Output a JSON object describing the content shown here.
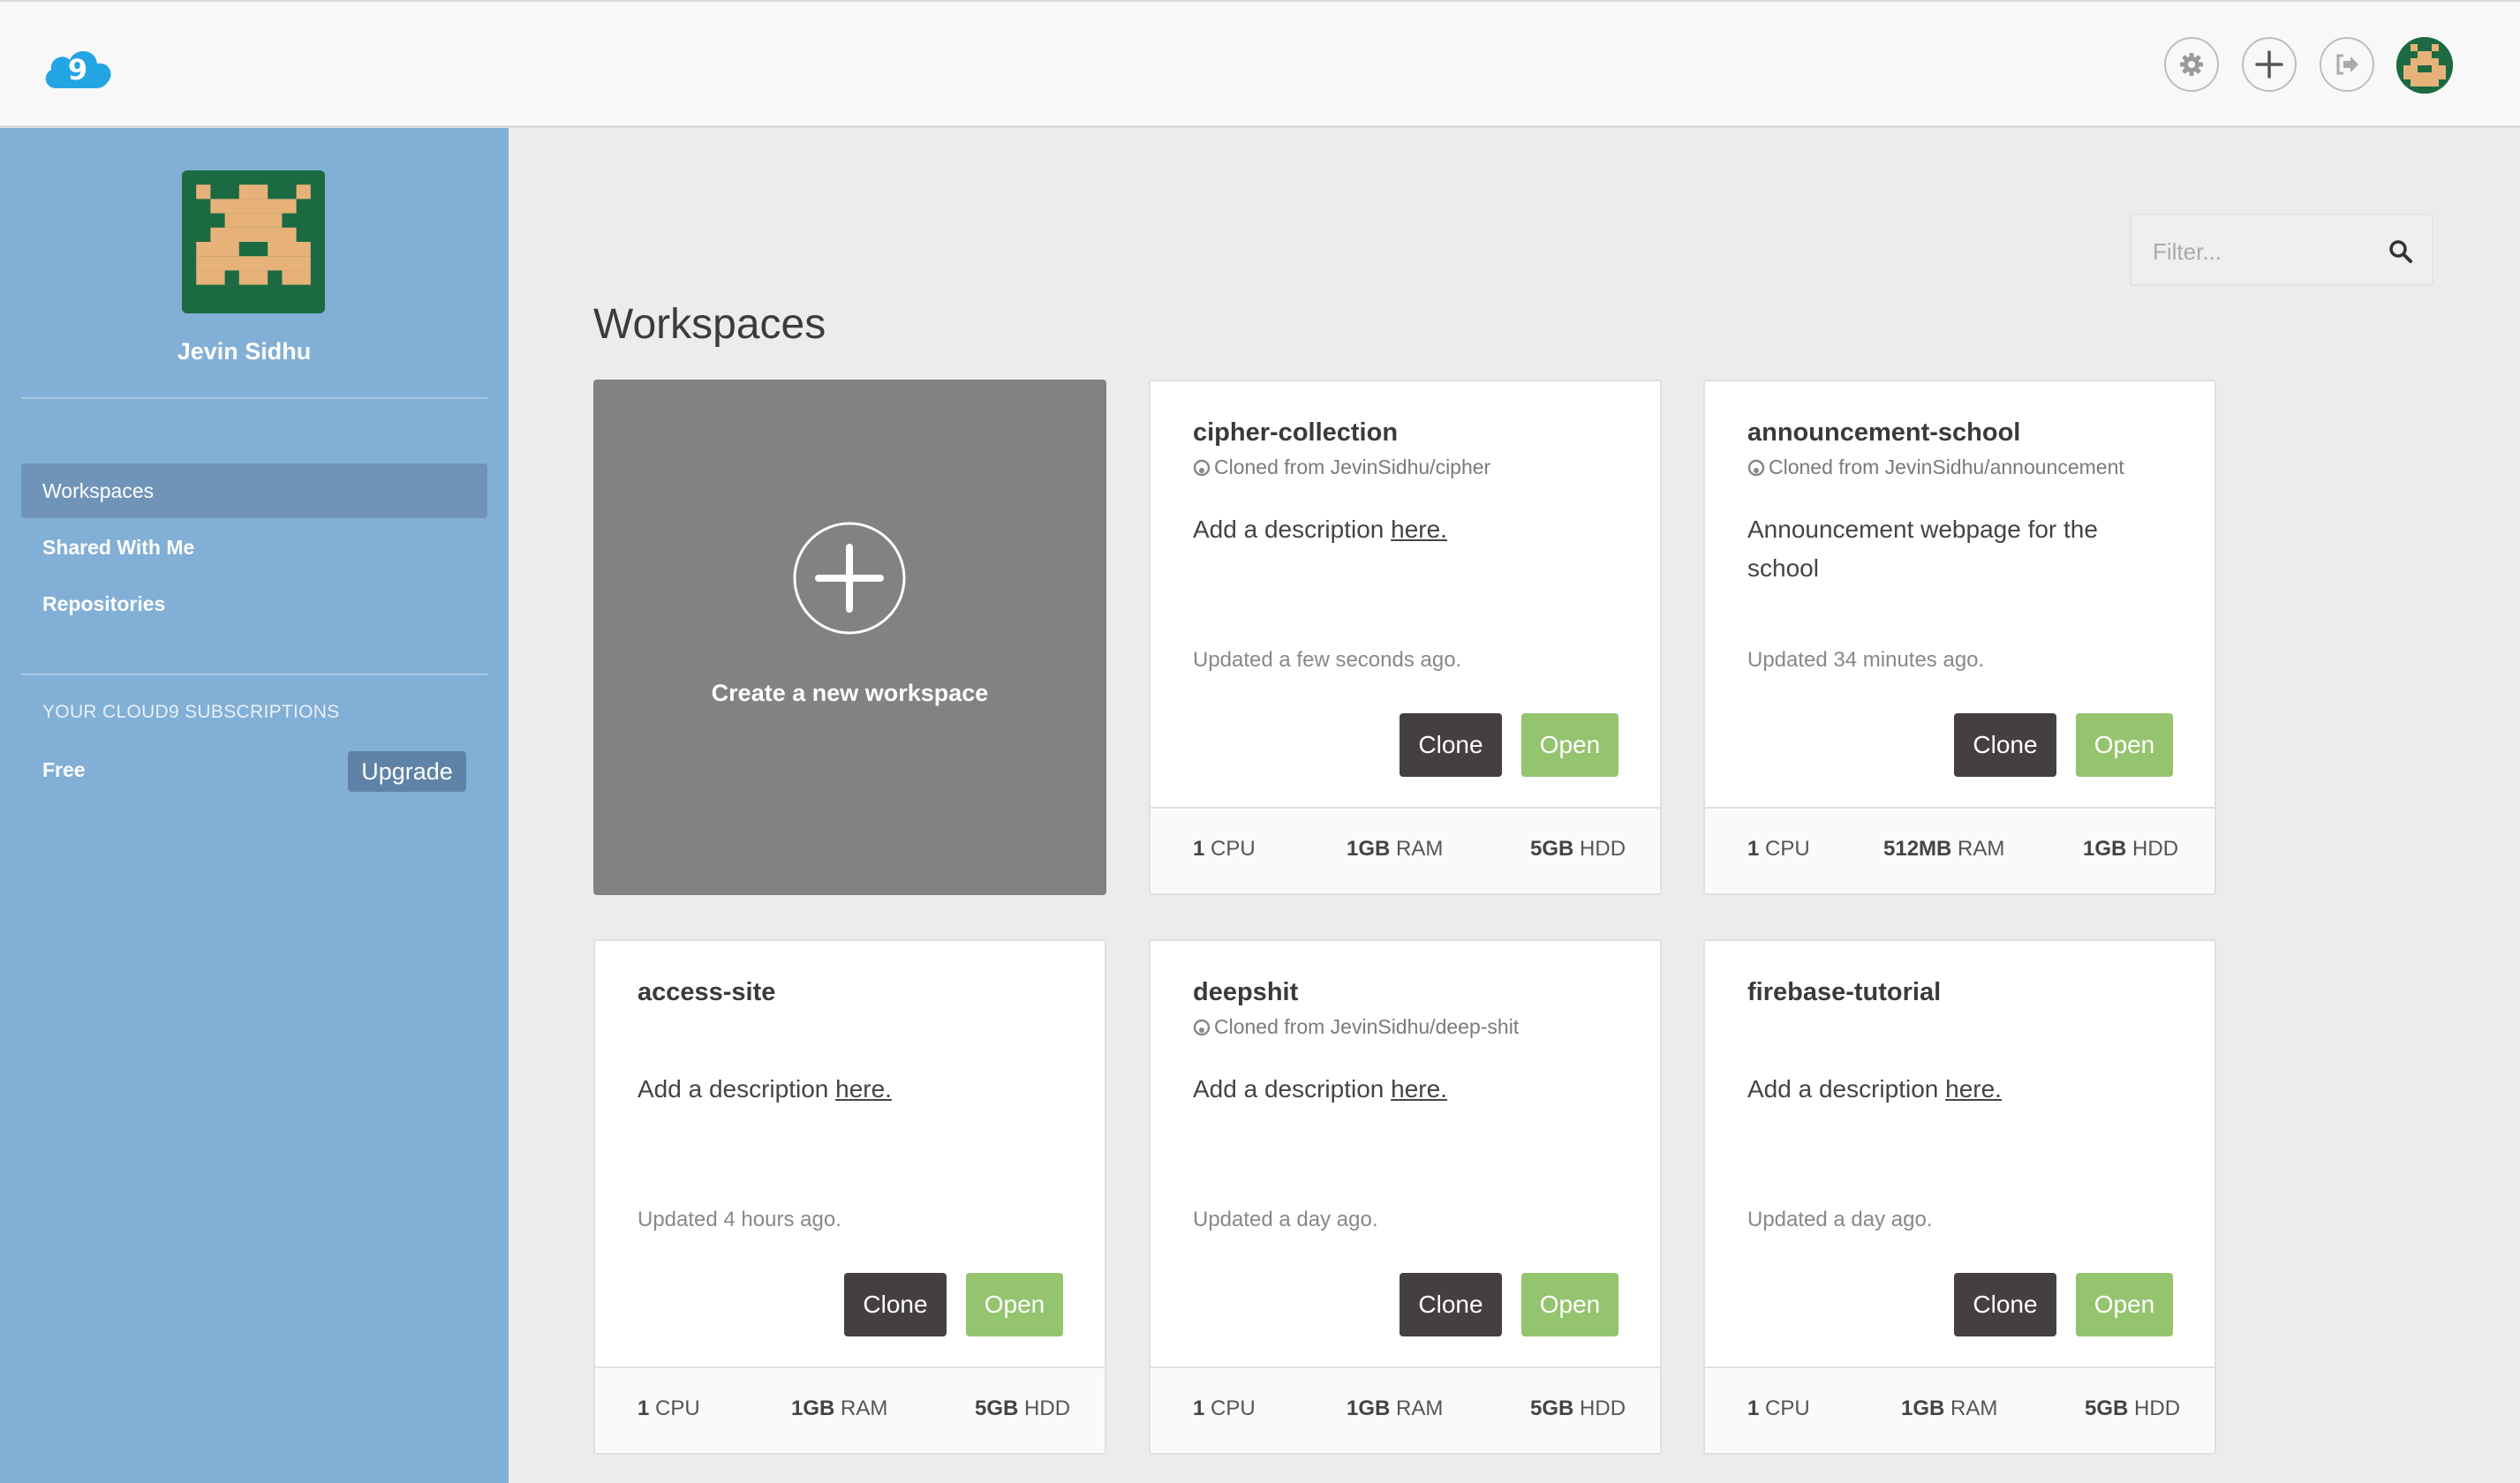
{
  "header": {
    "settings_icon": "gear-icon",
    "add_icon": "plus-icon",
    "logout_icon": "sign-out-icon",
    "logo_text": "9",
    "colors": {
      "logo": "#23a5e3",
      "bar": "#f8f8f8"
    }
  },
  "sidebar": {
    "user_name": "Jevin Sidhu",
    "nav": [
      {
        "label": "Workspaces",
        "active": true
      },
      {
        "label": "Shared With Me",
        "active": false
      },
      {
        "label": "Repositories",
        "active": false
      }
    ],
    "subscriptions_title": "YOUR CLOUD9 SUBSCRIPTIONS",
    "plan": "Free",
    "upgrade_label": "Upgrade",
    "colors": {
      "background": "#82afd5",
      "active_item": "#6f94b8"
    }
  },
  "main": {
    "title": "Workspaces",
    "filter": {
      "placeholder": "Filter...",
      "value": ""
    },
    "create_label": "Create a new workspace",
    "cards": [
      {
        "name": "cipher-collection",
        "source": "Cloned from JevinSidhu/cipher",
        "desc_prefix": "Add a description ",
        "desc_link": "here.",
        "updated": "Updated a few seconds ago.",
        "clone": "Clone",
        "open": "Open",
        "cpu_val": "1",
        "cpu_unit": "CPU",
        "ram_val": "1GB",
        "ram_unit": "RAM",
        "hdd_val": "5GB",
        "hdd_unit": "HDD"
      },
      {
        "name": "announcement-school",
        "source": "Cloned from JevinSidhu/announcement",
        "desc_text": "Announcement webpage for the school",
        "updated": "Updated 34 minutes ago.",
        "clone": "Clone",
        "open": "Open",
        "cpu_val": "1",
        "cpu_unit": "CPU",
        "ram_val": "512MB",
        "ram_unit": "RAM",
        "hdd_val": "1GB",
        "hdd_unit": "HDD"
      },
      {
        "name": "access-site",
        "desc_prefix": "Add a description ",
        "desc_link": "here.",
        "updated": "Updated 4 hours ago.",
        "clone": "Clone",
        "open": "Open",
        "cpu_val": "1",
        "cpu_unit": "CPU",
        "ram_val": "1GB",
        "ram_unit": "RAM",
        "hdd_val": "5GB",
        "hdd_unit": "HDD"
      },
      {
        "name": "deepshit",
        "source": "Cloned from JevinSidhu/deep-shit",
        "desc_prefix": "Add a description ",
        "desc_link": "here.",
        "updated": "Updated a day ago.",
        "clone": "Clone",
        "open": "Open",
        "cpu_val": "1",
        "cpu_unit": "CPU",
        "ram_val": "1GB",
        "ram_unit": "RAM",
        "hdd_val": "5GB",
        "hdd_unit": "HDD"
      },
      {
        "name": "firebase-tutorial",
        "desc_prefix": "Add a description ",
        "desc_link": "here.",
        "updated": "Updated a day ago.",
        "clone": "Clone",
        "open": "Open",
        "cpu_val": "1",
        "cpu_unit": "CPU",
        "ram_val": "1GB",
        "ram_unit": "RAM",
        "hdd_val": "5GB",
        "hdd_unit": "HDD"
      }
    ],
    "colors": {
      "clone": "#454040",
      "open": "#95c46f",
      "create_card": "#828282"
    }
  }
}
